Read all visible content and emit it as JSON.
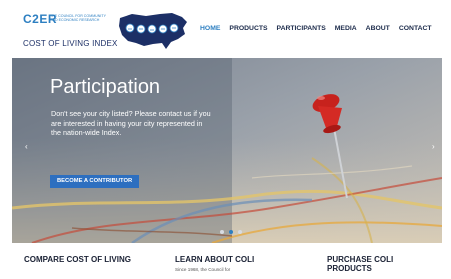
{
  "logo": {
    "brand": "C2ER",
    "tagline": "THE COUNCIL FOR COMMUNITY AND ECONOMIC RESEARCH",
    "product": "COST OF LIVING INDEX"
  },
  "nav": {
    "items": [
      "HOME",
      "PRODUCTS",
      "PARTICIPANTS",
      "MEDIA",
      "ABOUT",
      "CONTACT"
    ],
    "active": "HOME"
  },
  "hero": {
    "title": "Participation",
    "description": "Don't see your city listed? Please contact us if you are interested in having your city represented in the nation-wide Index.",
    "cta_label": "BECOME A CONTRIBUTOR",
    "arrow_left": "‹",
    "arrow_right": "›",
    "slides_total": 3,
    "active_slide": 2
  },
  "columns": [
    {
      "title": "COMPARE COST OF LIVING",
      "text": ""
    },
    {
      "title": "LEARN ABOUT COLI",
      "text": "Since 1968, the Council for"
    },
    {
      "title": "PURCHASE COLI PRODUCTS",
      "text": ""
    }
  ],
  "colors": {
    "accent": "#2d7fc1",
    "button": "#2d6fc0",
    "navy": "#1c2f66",
    "pin": "#d42a24"
  }
}
